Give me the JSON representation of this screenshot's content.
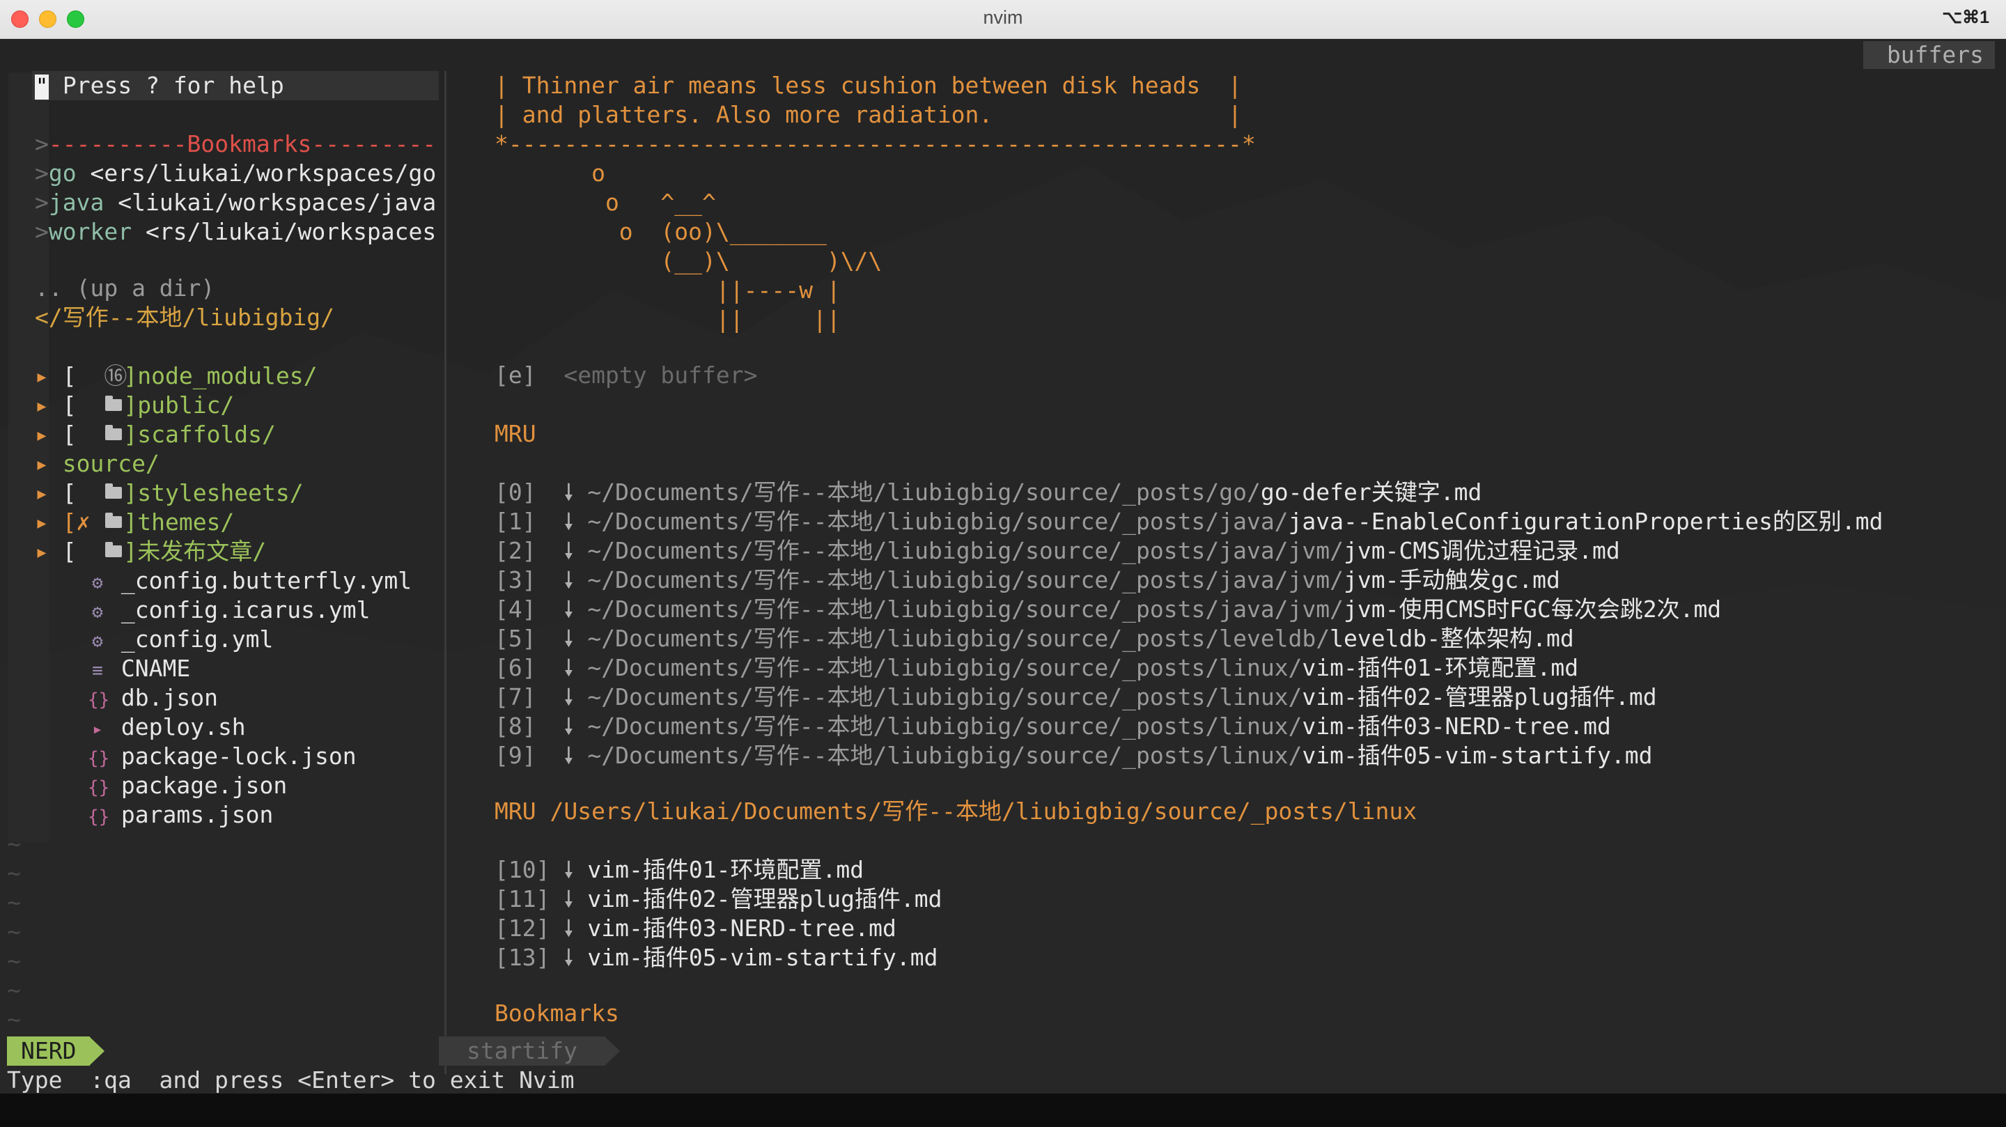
{
  "window": {
    "title": "nvim",
    "shortcut": "⌥⌘1"
  },
  "tabline": {
    "buffers_label": "buffers"
  },
  "nerdtree": {
    "help": "Press ? for help",
    "bookmarks_header": "----------Bookmarks---------",
    "bookmarks": [
      {
        "name": "go",
        "path": " <ers/liukai/workspaces/go"
      },
      {
        "name": "java",
        "path": " <liukai/workspaces/java"
      },
      {
        "name": "worker",
        "path": " <rs/liukai/workspaces"
      }
    ],
    "up_dir": ".. (up a dir)",
    "root": "</写作--本地/liubigbig/",
    "entries": [
      {
        "arrow": "▸",
        "git": "[  ",
        "icon": "npm-icon",
        "glyph": "⑯",
        "name": "]node_modules/",
        "kind": "dir"
      },
      {
        "arrow": "▸",
        "git": "[  ",
        "icon": "folder-icon",
        "name": "]public/",
        "kind": "dir"
      },
      {
        "arrow": "▸",
        "git": "[  ",
        "icon": "folder-icon",
        "name": "]scaffolds/",
        "kind": "dir"
      },
      {
        "arrow": "▸",
        "git": "",
        "icon": "",
        "name": "source/",
        "kind": "dir-plain"
      },
      {
        "arrow": "▸",
        "git": "[  ",
        "icon": "folder-icon",
        "name": "]stylesheets/",
        "kind": "dir"
      },
      {
        "arrow": "▸",
        "git": "[✗ ",
        "icon": "folder-icon",
        "name": "]themes/",
        "kind": "dir"
      },
      {
        "arrow": "▸",
        "git": "[  ",
        "icon": "folder-icon",
        "name": "]未发布文章/",
        "kind": "dir"
      }
    ],
    "files": [
      {
        "icon": "gear-icon",
        "glyph": "⚙",
        "name": "_config.butterfly.yml",
        "color": "#9a8ab0"
      },
      {
        "icon": "gear-icon",
        "glyph": "⚙",
        "name": "_config.icarus.yml",
        "color": "#9a8ab0"
      },
      {
        "icon": "gear-icon",
        "glyph": "⚙",
        "name": "_config.yml",
        "color": "#9a8ab0"
      },
      {
        "icon": "lines-icon",
        "glyph": "≡",
        "name": "CNAME",
        "color": "#9a8ab0"
      },
      {
        "icon": "braces-icon",
        "glyph": "{}",
        "name": "db.json",
        "color": "#c26a9a"
      },
      {
        "icon": "terminal-icon",
        "glyph": "▸",
        "name": "deploy.sh",
        "color": "#c26a9a"
      },
      {
        "icon": "braces-icon",
        "glyph": "{}",
        "name": "package-lock.json",
        "color": "#c26a9a"
      },
      {
        "icon": "braces-icon",
        "glyph": "{}",
        "name": "package.json",
        "color": "#c26a9a"
      },
      {
        "icon": "braces-icon",
        "glyph": "{}",
        "name": "params.json",
        "color": "#c26a9a"
      }
    ],
    "status": "NERD"
  },
  "startify": {
    "cowsay": [
      "| Thinner air means less cushion between disk heads  |",
      "| and platters. Also more radiation.                 |",
      "*-----------------------------------------------------*",
      "       o",
      "        o   ^__^",
      "         o  (oo)\\_______",
      "            (__)\\       )\\/\\",
      "                ||----w |",
      "                ||     ||"
    ],
    "empty_key": "[e]",
    "empty_label": "<empty buffer>",
    "mru_header": "MRU",
    "mru": [
      {
        "key": "[0]",
        "dir": "~/Documents/写作--本地/liubigbig/source/_posts/go/",
        "file": "go-defer关键字.md"
      },
      {
        "key": "[1]",
        "dir": "~/Documents/写作--本地/liubigbig/source/_posts/java/",
        "file": "java--EnableConfigurationProperties的区别.md"
      },
      {
        "key": "[2]",
        "dir": "~/Documents/写作--本地/liubigbig/source/_posts/java/jvm/",
        "file": "jvm-CMS调优过程记录.md"
      },
      {
        "key": "[3]",
        "dir": "~/Documents/写作--本地/liubigbig/source/_posts/java/jvm/",
        "file": "jvm-手动触发gc.md"
      },
      {
        "key": "[4]",
        "dir": "~/Documents/写作--本地/liubigbig/source/_posts/java/jvm/",
        "file": "jvm-使用CMS时FGC每次会跳2次.md"
      },
      {
        "key": "[5]",
        "dir": "~/Documents/写作--本地/liubigbig/source/_posts/leveldb/",
        "file": "leveldb-整体架构.md"
      },
      {
        "key": "[6]",
        "dir": "~/Documents/写作--本地/liubigbig/source/_posts/linux/",
        "file": "vim-插件01-环境配置.md"
      },
      {
        "key": "[7]",
        "dir": "~/Documents/写作--本地/liubigbig/source/_posts/linux/",
        "file": "vim-插件02-管理器plug插件.md"
      },
      {
        "key": "[8]",
        "dir": "~/Documents/写作--本地/liubigbig/source/_posts/linux/",
        "file": "vim-插件03-NERD-tree.md"
      },
      {
        "key": "[9]",
        "dir": "~/Documents/写作--本地/liubigbig/source/_posts/linux/",
        "file": "vim-插件05-vim-startify.md"
      }
    ],
    "mru_dir_header": "MRU /Users/liukai/Documents/写作--本地/liubigbig/source/_posts/linux",
    "mru_dir": [
      {
        "key": "[10]",
        "file": "vim-插件01-环境配置.md"
      },
      {
        "key": "[11]",
        "file": "vim-插件02-管理器plug插件.md"
      },
      {
        "key": "[12]",
        "file": "vim-插件03-NERD-tree.md"
      },
      {
        "key": "[13]",
        "file": "vim-插件05-vim-startify.md"
      }
    ],
    "bookmarks_header": "Bookmarks",
    "status": "startify"
  },
  "cmdline": "Type  :qa  and press <Enter> to exit Nvim"
}
